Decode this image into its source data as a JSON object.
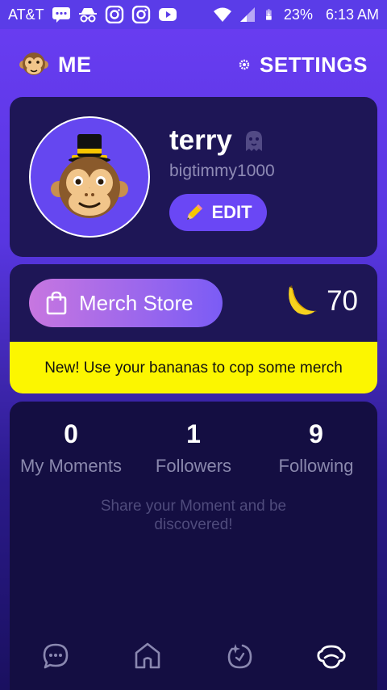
{
  "status_bar": {
    "carrier": "AT&T",
    "battery": "23%",
    "time": "6:13 AM",
    "icons": [
      "chat-icon",
      "incognito-icon",
      "instagram-icon",
      "instagram-icon",
      "youtube-icon",
      "wifi-icon",
      "signal-icon",
      "battery-icon"
    ]
  },
  "header": {
    "me_label": "ME",
    "settings_label": "SETTINGS"
  },
  "profile": {
    "name": "terry",
    "handle": "bigtimmy1000",
    "edit_label": "EDIT"
  },
  "merch": {
    "button_label": "Merch Store",
    "banana_count": "70",
    "promo_text": "New! Use your bananas to cop some merch"
  },
  "stats": {
    "items": [
      {
        "value": "0",
        "label": "My Moments"
      },
      {
        "value": "1",
        "label": "Followers"
      },
      {
        "value": "9",
        "label": "Following"
      }
    ],
    "hint": "Share your Moment and be discovered!"
  },
  "nav": {
    "items": [
      "chat-icon",
      "home-icon",
      "moments-icon",
      "profile-icon"
    ],
    "active": "profile-icon"
  },
  "colors": {
    "accent": "#6a47f5",
    "promo_bg": "#fcf600",
    "card_bg": "#1e1656"
  }
}
